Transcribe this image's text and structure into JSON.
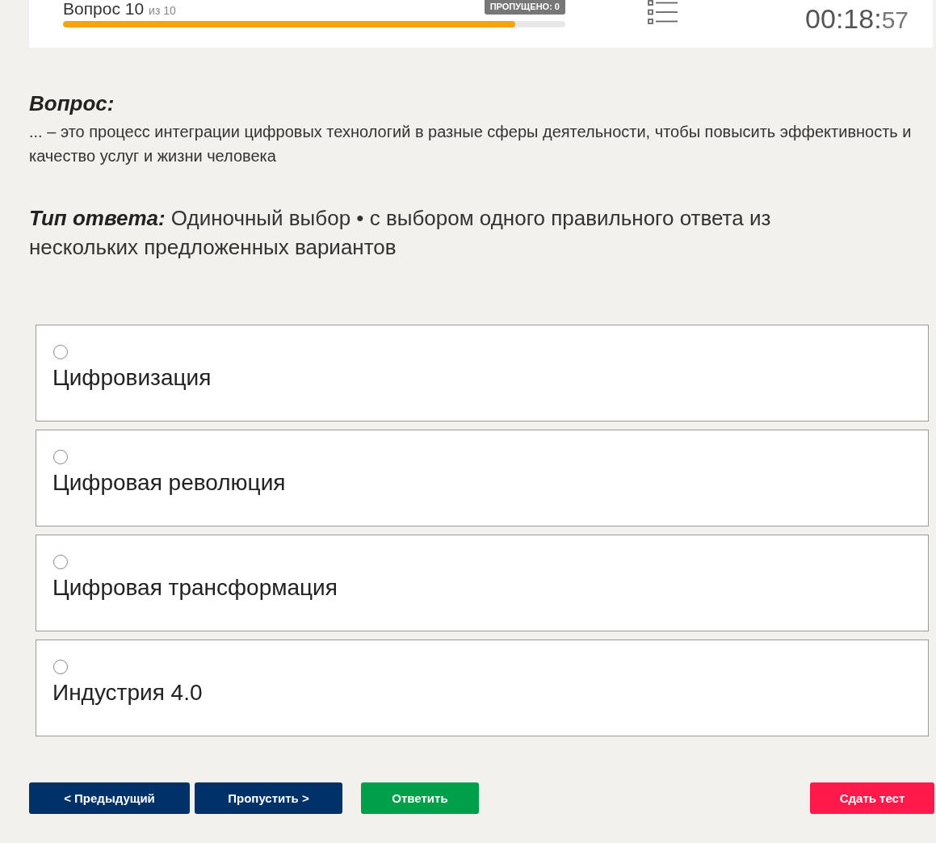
{
  "header": {
    "question_label": "Вопрос 10",
    "question_total": "из 10",
    "skipped_badge": "ПРОПУЩЕНО: 0",
    "progress": {
      "level": 0.9
    },
    "timer": {
      "main": "00:18:",
      "seconds": "57"
    }
  },
  "question": {
    "heading": "Вопрос:",
    "text": "... – это процесс интеграции цифровых технологий в разные сферы деятельности, чтобы повысить эффективность и качество услуг и жизни человека"
  },
  "answer_type": {
    "text": "**Тип ответа:** Одиночный выбор • с выбором одного правильного ответа из нескольких предложенных вариантов"
  },
  "options": [
    {
      "label": "Цифровизация",
      "selected": false
    },
    {
      "label": "Цифровая революция",
      "selected": false
    },
    {
      "label": "Цифровая трансформация",
      "selected": false
    },
    {
      "label": "Индустрия 4.0",
      "selected": false
    }
  ],
  "buttons": [
    {
      "label": "< Предыдущий",
      "kind": "nav"
    },
    {
      "label": "Пропустить >",
      "kind": "nav"
    },
    {
      "label": "Ответить",
      "kind": "submit"
    },
    {
      "label": "Сдать тест",
      "kind": "finish"
    }
  ]
}
